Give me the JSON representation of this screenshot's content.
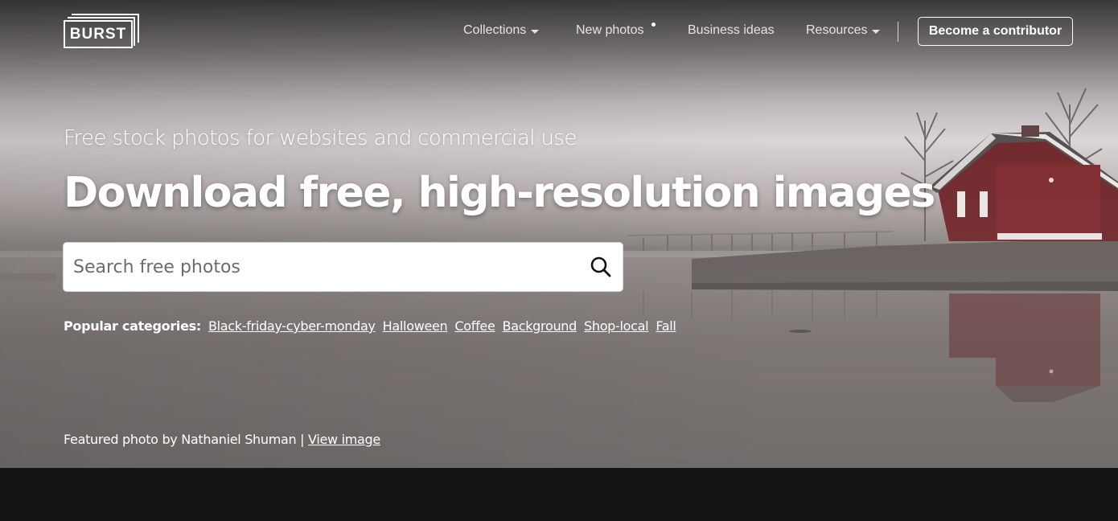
{
  "header": {
    "logo_text": "BURST",
    "nav": [
      {
        "label": "Collections",
        "has_dropdown": true
      },
      {
        "label": "New photos",
        "has_indicator": true
      },
      {
        "label": "Business ideas"
      },
      {
        "label": "Resources",
        "has_dropdown": true
      }
    ],
    "cta_label": "Become a contributor"
  },
  "hero": {
    "subtitle": "Free stock photos for websites and commercial use",
    "title": "Download free, high-resolution images",
    "search": {
      "placeholder": "Search free photos",
      "value": ""
    },
    "popular": {
      "label": "Popular categories:",
      "items": [
        "Black-friday-cyber-monday",
        "Halloween",
        "Coffee",
        "Background",
        "Shop-local",
        "Fall"
      ]
    },
    "credit": {
      "text": "Featured photo by Nathaniel Shuman |",
      "link": "View image"
    }
  },
  "colors": {
    "text": "#ffffff",
    "bottom_band": "#141414",
    "house_red": "#6b2024"
  },
  "icons": {
    "search": "search-icon",
    "dropdown": "caret-down-icon"
  }
}
